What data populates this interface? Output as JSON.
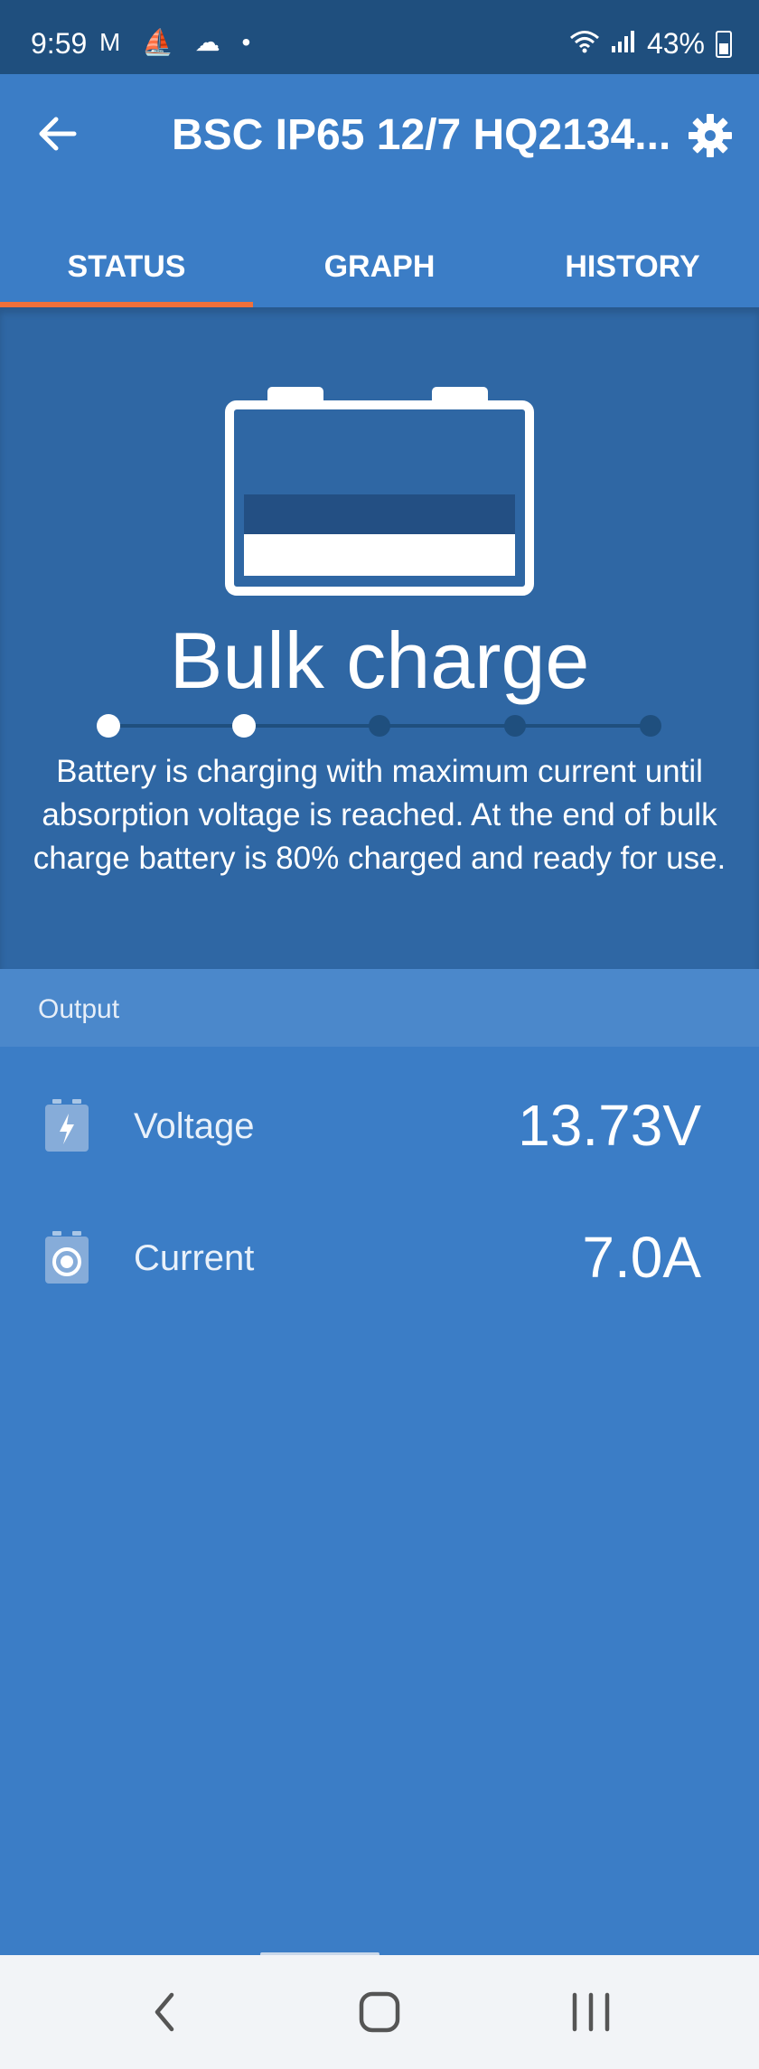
{
  "status_bar": {
    "time": "9:59",
    "notification_icons": [
      "gmail-icon",
      "boat-icon",
      "cloud-icon",
      "dot-icon"
    ],
    "battery_percent": "43%"
  },
  "app_bar": {
    "title": "BSC IP65 12/7 HQ2134...",
    "back_icon": "arrow-left-icon",
    "settings_icon": "gear-icon"
  },
  "tabs": [
    {
      "label": "STATUS",
      "active": true
    },
    {
      "label": "GRAPH",
      "active": false
    },
    {
      "label": "HISTORY",
      "active": false
    }
  ],
  "status": {
    "phase_title": "Bulk charge",
    "steps_total": 5,
    "steps_completed": 2,
    "description": "Battery is charging with maximum current until absorption voltage is reached. At the end of bulk charge battery is 80% charged and ready for use."
  },
  "output": {
    "section_label": "Output",
    "rows": [
      {
        "label": "Voltage",
        "value": "13.73V",
        "icon": "battery-bolt-icon"
      },
      {
        "label": "Current",
        "value": "7.0A",
        "icon": "battery-current-icon"
      }
    ]
  },
  "colors": {
    "primary": "#3b7dc6",
    "hero_bg": "#2f67a4",
    "status_bar": "#1f4f7e",
    "tab_indicator": "#f0703a",
    "section_header": "#4b88cb"
  },
  "nav_bar": {
    "icons": [
      "back-chevron-icon",
      "home-icon",
      "recents-icon"
    ]
  }
}
